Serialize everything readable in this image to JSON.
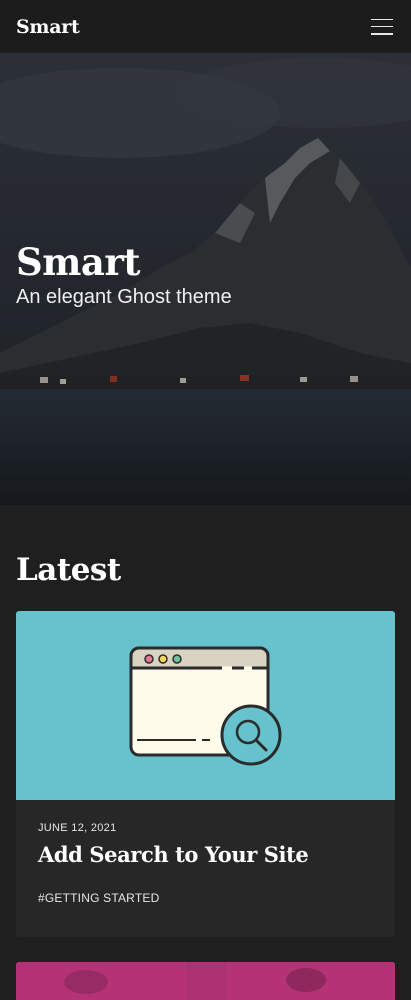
{
  "header": {
    "brand": "Smart"
  },
  "hero": {
    "title": "Smart",
    "subtitle": "An elegant Ghost theme"
  },
  "latest": {
    "heading": "Latest",
    "posts": [
      {
        "date": "JUNE 12, 2021",
        "title": "Add Search to Your Site",
        "tag": "#GETTING STARTED"
      }
    ]
  },
  "icons": [
    "menu-icon",
    "browser-window-icon",
    "magnifier-icon"
  ],
  "colors": {
    "background": "#1f1f1f",
    "card": "#272727",
    "card_image": "#66c2cc",
    "second_card": "#c2397f"
  }
}
